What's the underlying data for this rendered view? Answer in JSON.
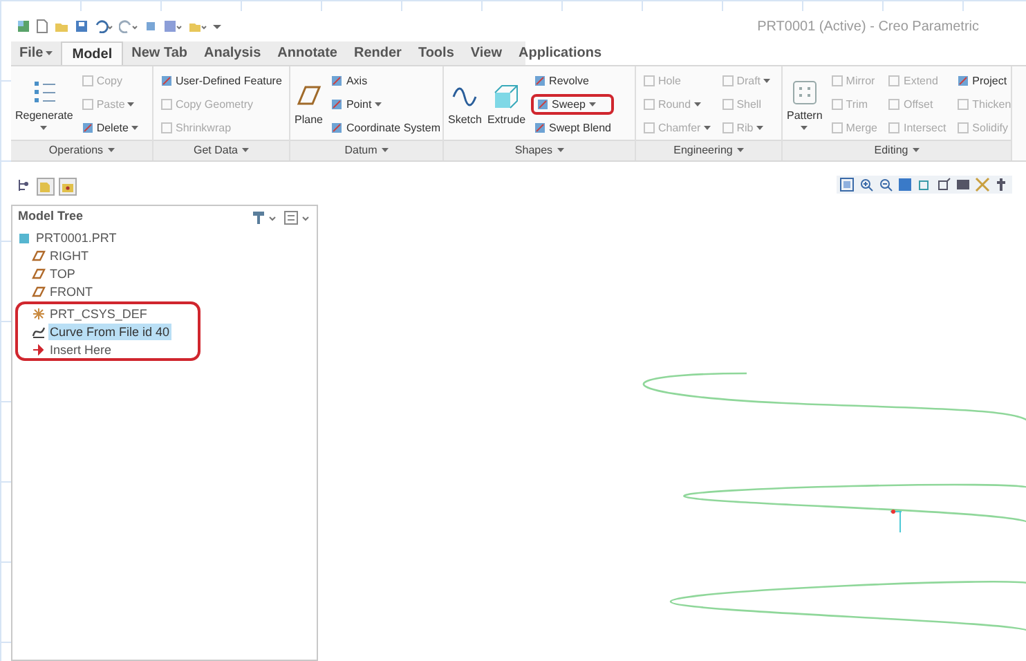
{
  "window": {
    "title": "PRT0001 (Active) - Creo Parametric"
  },
  "tabs": [
    {
      "label": "File",
      "dropdown": true,
      "selected": false
    },
    {
      "label": "Model",
      "dropdown": false,
      "selected": true
    },
    {
      "label": "New Tab",
      "dropdown": false,
      "selected": false
    },
    {
      "label": "Analysis",
      "dropdown": false,
      "selected": false
    },
    {
      "label": "Annotate",
      "dropdown": false,
      "selected": false
    },
    {
      "label": "Render",
      "dropdown": false,
      "selected": false
    },
    {
      "label": "Tools",
      "dropdown": false,
      "selected": false
    },
    {
      "label": "View",
      "dropdown": false,
      "selected": false
    },
    {
      "label": "Applications",
      "dropdown": false,
      "selected": false
    }
  ],
  "ribbon": {
    "groups": [
      {
        "label": "Operations",
        "columns": [
          {
            "kind": "large",
            "items": [
              {
                "label": "Regenerate",
                "disabled": false,
                "dropdown": true,
                "highlighted": false
              }
            ]
          },
          {
            "kind": "small",
            "items": [
              {
                "label": "Copy",
                "disabled": true,
                "dropdown": false,
                "highlighted": false
              },
              {
                "label": "Paste",
                "disabled": true,
                "dropdown": true,
                "highlighted": false
              },
              {
                "label": "Delete",
                "disabled": false,
                "dropdown": true,
                "highlighted": false
              }
            ]
          }
        ]
      },
      {
        "label": "Get Data",
        "columns": [
          {
            "kind": "small",
            "items": [
              {
                "label": "User-Defined Feature",
                "disabled": false,
                "dropdown": false,
                "highlighted": false
              },
              {
                "label": "Copy Geometry",
                "disabled": true,
                "dropdown": false,
                "highlighted": false
              },
              {
                "label": "Shrinkwrap",
                "disabled": true,
                "dropdown": false,
                "highlighted": false
              }
            ]
          }
        ]
      },
      {
        "label": "Datum",
        "columns": [
          {
            "kind": "large",
            "items": [
              {
                "label": "Plane",
                "disabled": false,
                "dropdown": false,
                "highlighted": false
              }
            ]
          },
          {
            "kind": "small",
            "items": [
              {
                "label": "Axis",
                "disabled": false,
                "dropdown": false,
                "highlighted": false
              },
              {
                "label": "Point",
                "disabled": false,
                "dropdown": true,
                "highlighted": false
              },
              {
                "label": "Coordinate System",
                "disabled": false,
                "dropdown": false,
                "highlighted": false
              }
            ]
          }
        ]
      },
      {
        "label": "Shapes",
        "columns": [
          {
            "kind": "large",
            "items": [
              {
                "label": "Sketch",
                "disabled": false,
                "dropdown": false,
                "highlighted": false
              }
            ]
          },
          {
            "kind": "large",
            "items": [
              {
                "label": "Extrude",
                "disabled": false,
                "dropdown": false,
                "highlighted": false
              }
            ]
          },
          {
            "kind": "small",
            "items": [
              {
                "label": "Revolve",
                "disabled": false,
                "dropdown": false,
                "highlighted": false
              },
              {
                "label": "Sweep",
                "disabled": false,
                "dropdown": true,
                "highlighted": true
              },
              {
                "label": "Swept Blend",
                "disabled": false,
                "dropdown": false,
                "highlighted": false
              }
            ]
          }
        ]
      },
      {
        "label": "Engineering",
        "columns": [
          {
            "kind": "small",
            "items": [
              {
                "label": "Hole",
                "disabled": true,
                "dropdown": false,
                "highlighted": false
              },
              {
                "label": "Round",
                "disabled": true,
                "dropdown": true,
                "highlighted": false
              },
              {
                "label": "Chamfer",
                "disabled": true,
                "dropdown": true,
                "highlighted": false
              }
            ]
          },
          {
            "kind": "small",
            "items": [
              {
                "label": "Draft",
                "disabled": true,
                "dropdown": true,
                "highlighted": false
              },
              {
                "label": "Shell",
                "disabled": true,
                "dropdown": false,
                "highlighted": false
              },
              {
                "label": "Rib",
                "disabled": true,
                "dropdown": true,
                "highlighted": false
              }
            ]
          }
        ]
      },
      {
        "label": "Editing",
        "columns": [
          {
            "kind": "large",
            "items": [
              {
                "label": "Pattern",
                "disabled": false,
                "dropdown": true,
                "highlighted": false
              }
            ]
          },
          {
            "kind": "small",
            "items": [
              {
                "label": "Mirror",
                "disabled": true,
                "dropdown": false,
                "highlighted": false
              },
              {
                "label": "Trim",
                "disabled": true,
                "dropdown": false,
                "highlighted": false
              },
              {
                "label": "Merge",
                "disabled": true,
                "dropdown": false,
                "highlighted": false
              }
            ]
          },
          {
            "kind": "small",
            "items": [
              {
                "label": "Extend",
                "disabled": true,
                "dropdown": false,
                "highlighted": false
              },
              {
                "label": "Offset",
                "disabled": true,
                "dropdown": false,
                "highlighted": false
              },
              {
                "label": "Intersect",
                "disabled": true,
                "dropdown": false,
                "highlighted": false
              }
            ]
          },
          {
            "kind": "small",
            "items": [
              {
                "label": "Project",
                "disabled": false,
                "dropdown": false,
                "highlighted": false
              },
              {
                "label": "Thicken",
                "disabled": true,
                "dropdown": false,
                "highlighted": false
              },
              {
                "label": "Solidify",
                "disabled": true,
                "dropdown": false,
                "highlighted": false
              }
            ]
          }
        ]
      }
    ]
  },
  "model_tree": {
    "title": "Model Tree",
    "items": [
      {
        "label": "PRT0001.PRT",
        "kind": "part",
        "selected": false,
        "highlighted": false,
        "children": [
          {
            "label": "RIGHT",
            "kind": "plane",
            "selected": false,
            "highlighted": false
          },
          {
            "label": "TOP",
            "kind": "plane",
            "selected": false,
            "highlighted": false
          },
          {
            "label": "FRONT",
            "kind": "plane",
            "selected": false,
            "highlighted": false
          },
          {
            "label": "PRT_CSYS_DEF",
            "kind": "csys",
            "selected": false,
            "highlighted": true
          },
          {
            "label": "Curve From File id 40",
            "kind": "curve",
            "selected": true,
            "highlighted": true
          },
          {
            "label": "Insert Here",
            "kind": "insert",
            "selected": false,
            "highlighted": true
          }
        ]
      }
    ]
  }
}
